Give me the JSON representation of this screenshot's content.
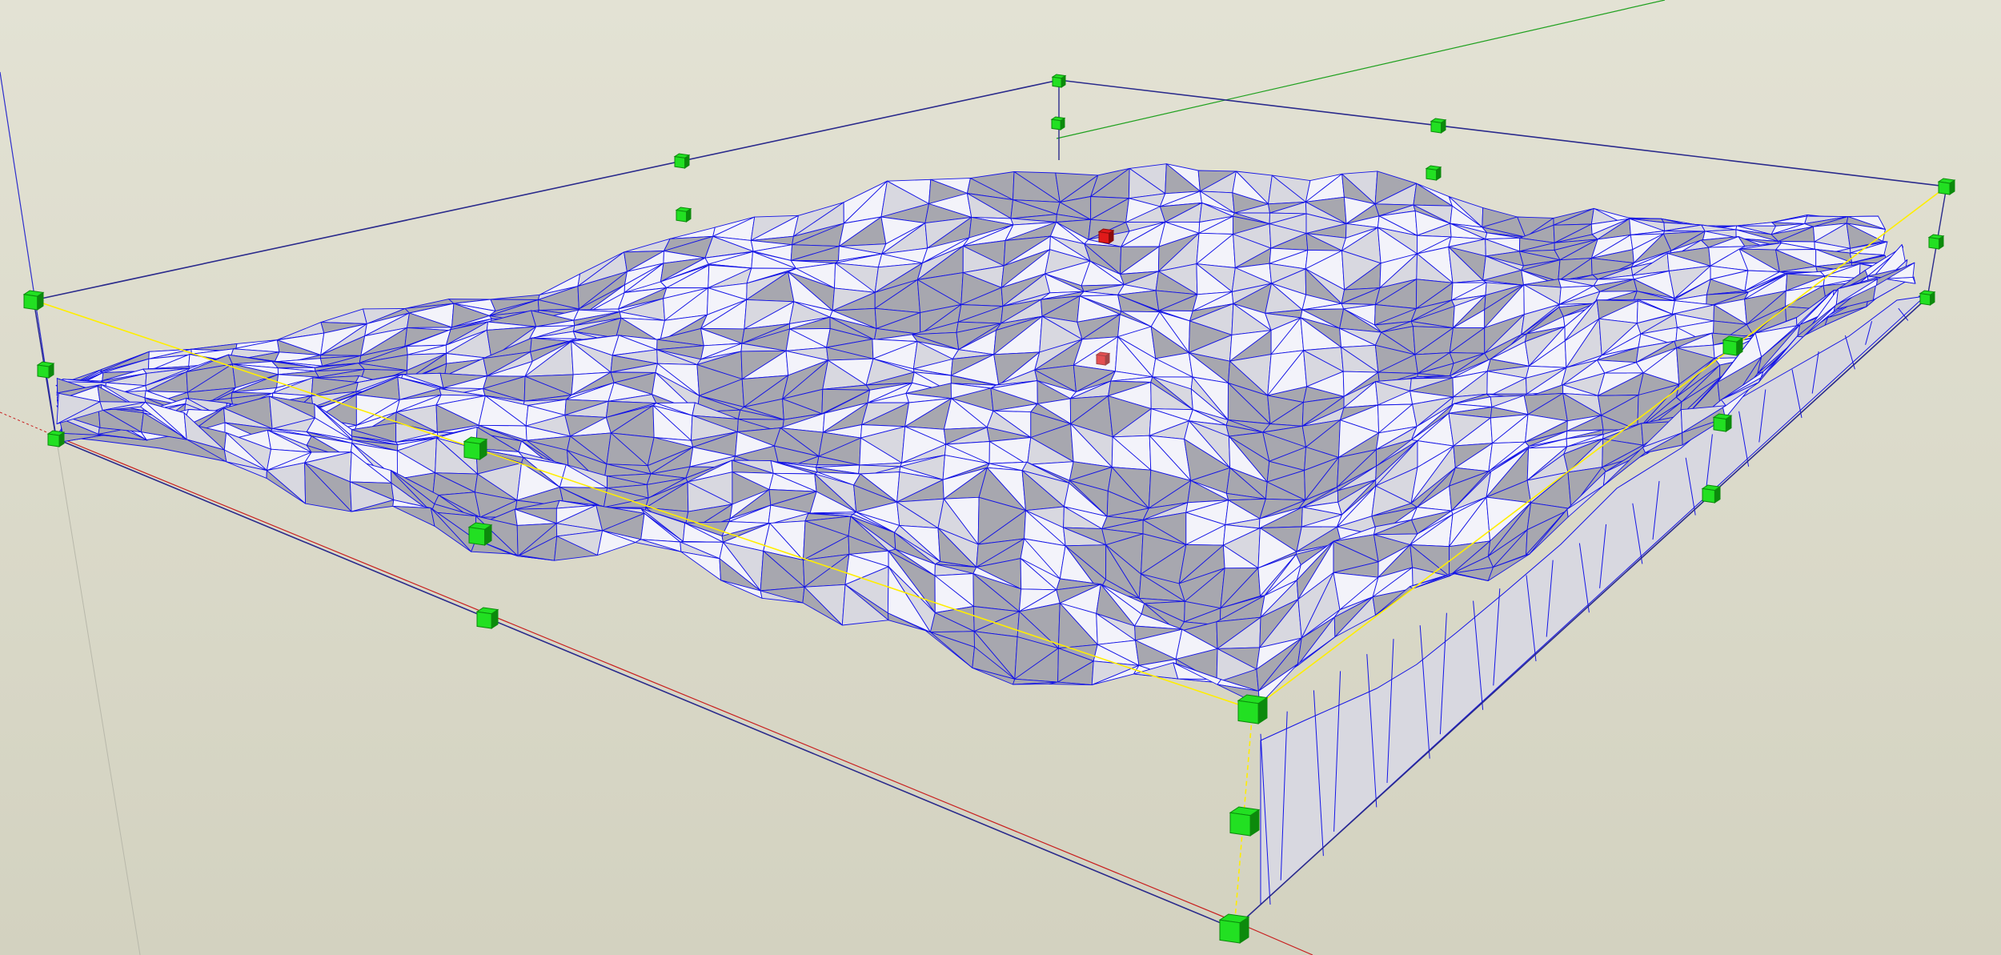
{
  "viewport": {
    "background_top": "#e3e2d4",
    "background_bottom": "#d3d2c0"
  },
  "colors": {
    "wireframe_edge": "#1414e6",
    "face_light": "#f3f3fa",
    "face_mid": "#d8d8e0",
    "face_dark": "#a7a7af",
    "bounding_box": "#2a2a8c",
    "bounding_box_highlight": "#ffee00",
    "grip": "#22e022",
    "grip_dark": "#0c8a0c",
    "pivot": "#e01a1a",
    "axis_red": "#c81e1e",
    "axis_green": "#1ea01e",
    "axis_blue": "#2d2dcc"
  },
  "icons": {
    "scale_grip": "green-cube-icon",
    "pivot_marker": "red-cube-icon"
  }
}
